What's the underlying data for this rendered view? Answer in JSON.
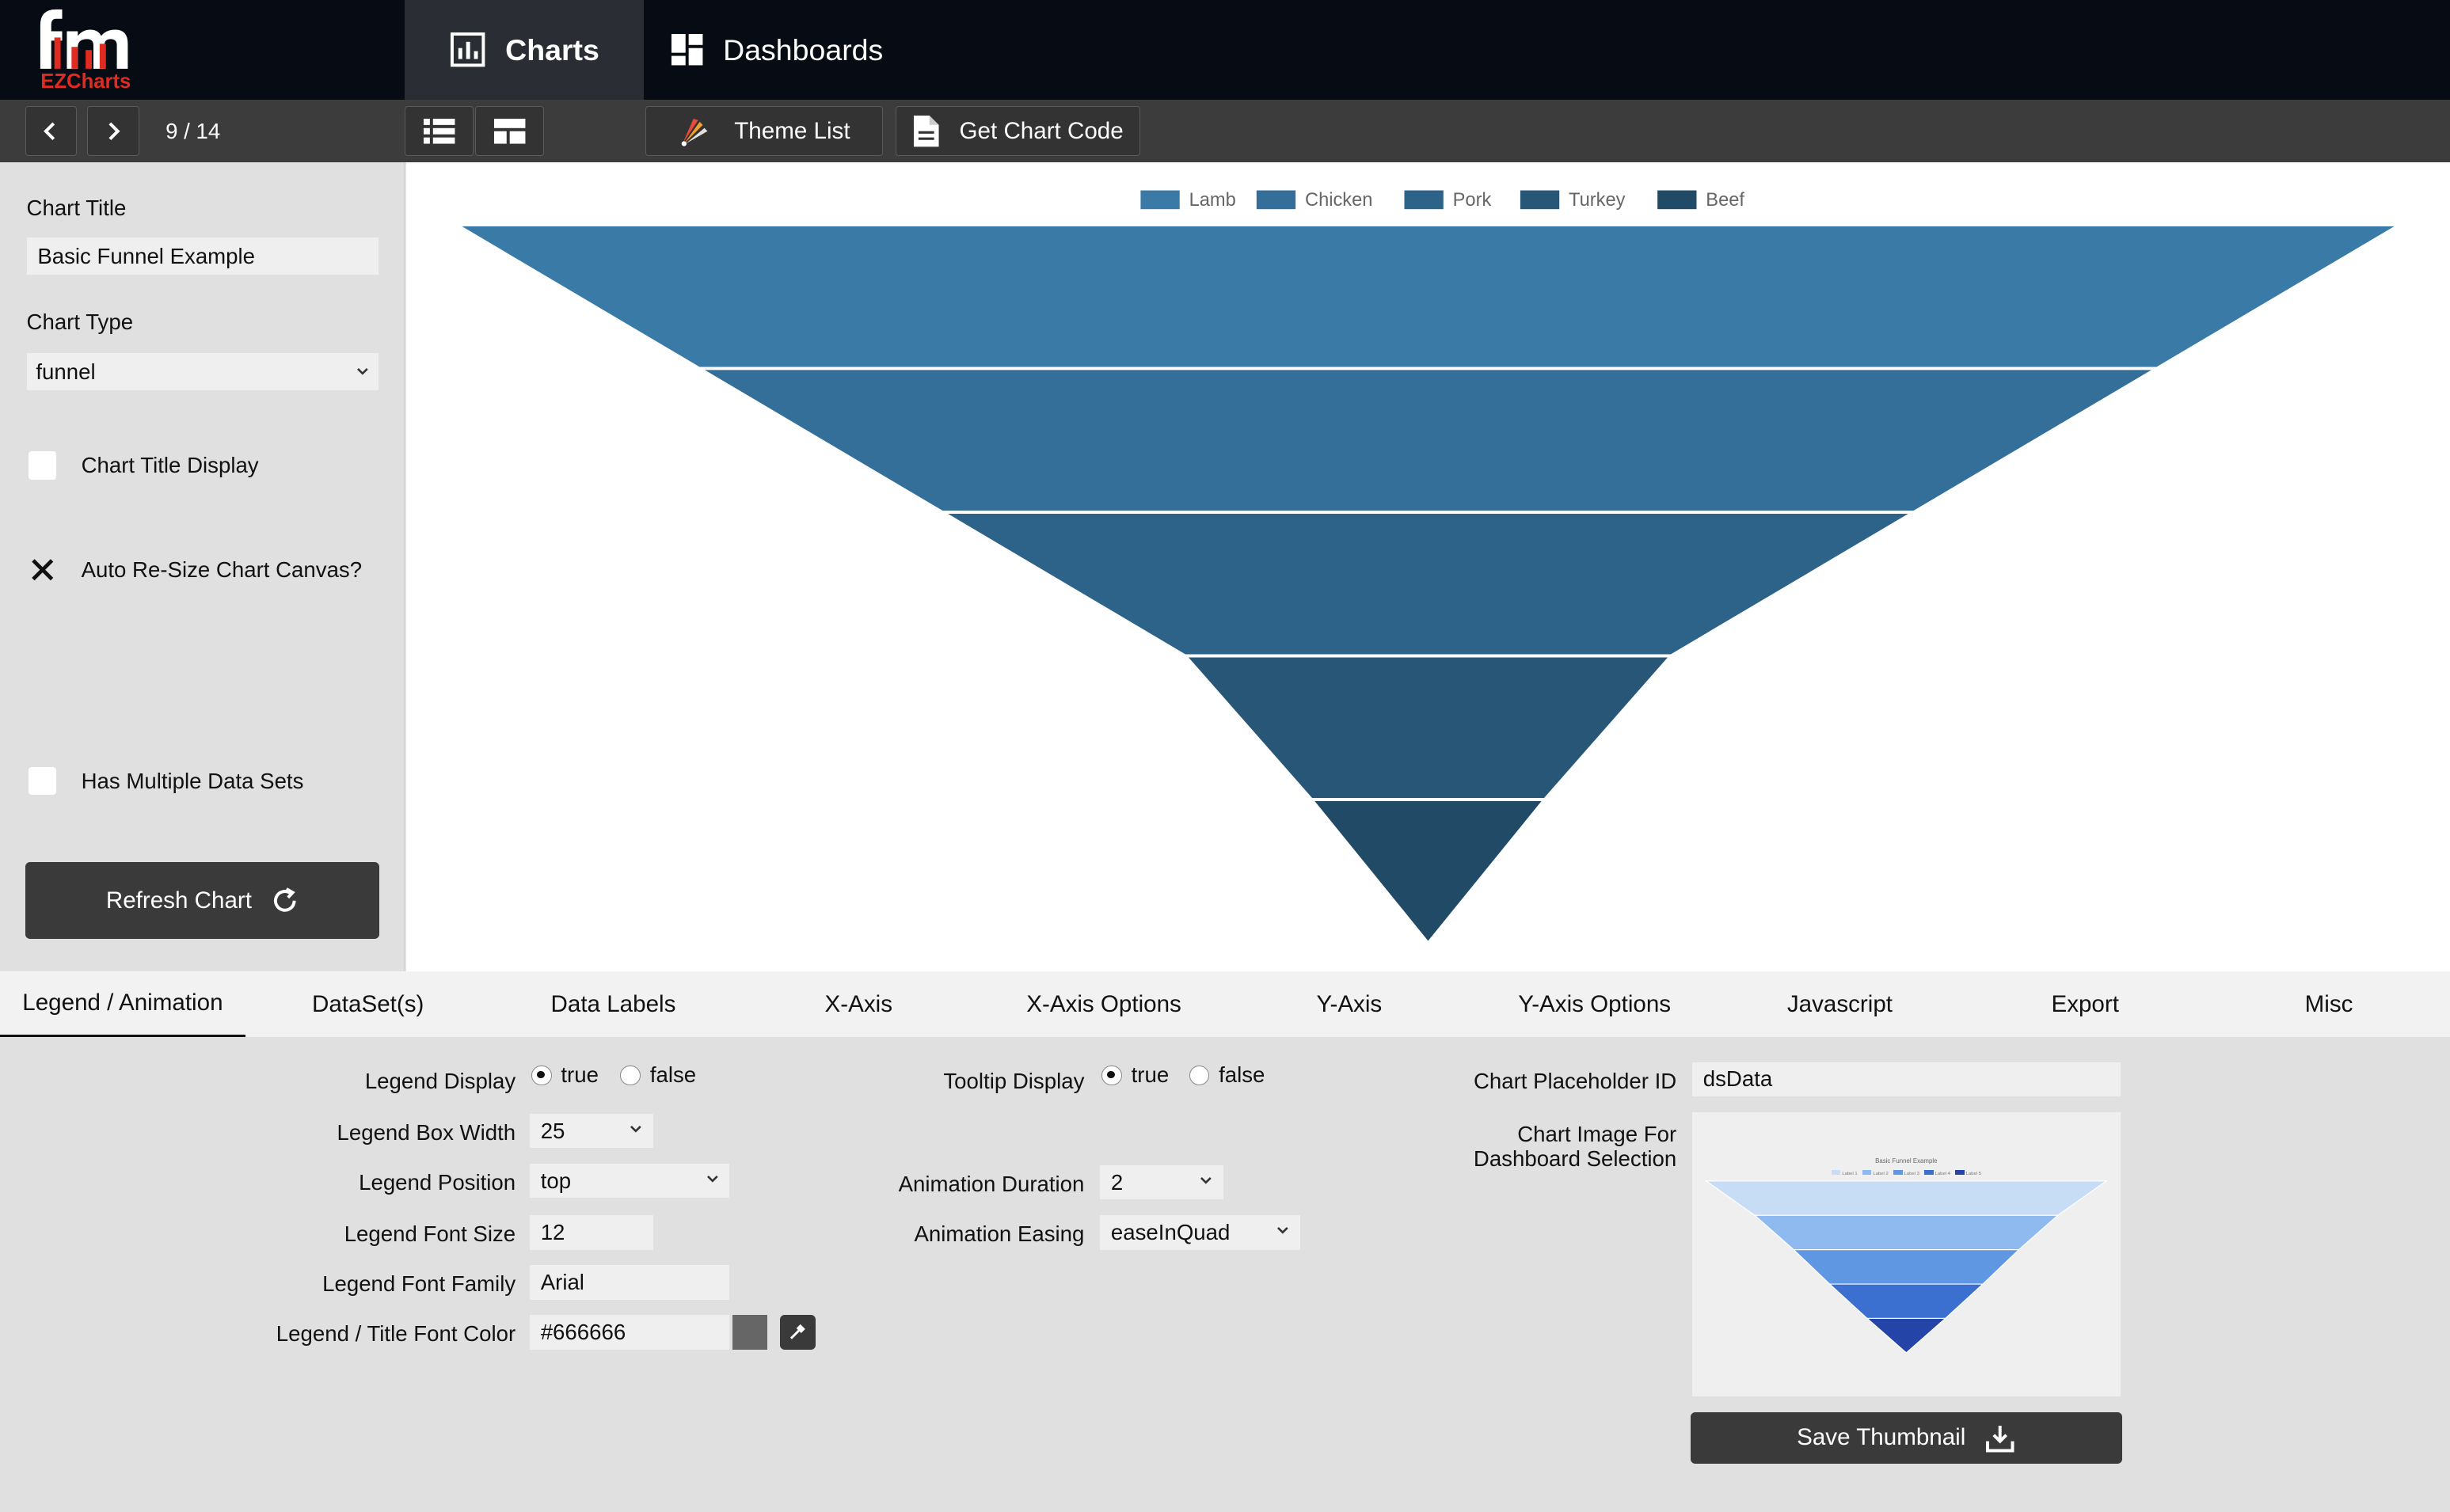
{
  "app": {
    "logo_text": "fm",
    "logo_subtext": "EZCharts",
    "nav_tabs": [
      {
        "label": "Charts",
        "icon": "bar-chart-icon"
      },
      {
        "label": "Dashboards",
        "icon": "dashboard-grid-icon"
      }
    ]
  },
  "toolbar": {
    "pager": "9 / 14",
    "theme_list_label": "Theme List",
    "get_code_label": "Get Chart Code"
  },
  "left_panel": {
    "chart_title_label": "Chart Title",
    "chart_title_value": "Basic Funnel Example",
    "chart_type_label": "Chart Type",
    "chart_type_value": "funnel",
    "title_display_label": "Chart Title Display",
    "title_display_checked": false,
    "auto_resize_label": "Auto Re-Size Chart Canvas?",
    "auto_resize_checked": true,
    "multi_dataset_label": "Has Multiple Data Sets",
    "multi_dataset_checked": false,
    "refresh_label": "Refresh Chart"
  },
  "chart_data": {
    "type": "funnel",
    "categories": [
      "Lamb",
      "Chicken",
      "Pork",
      "Turkey",
      "Beef"
    ],
    "values": [
      100,
      75,
      50,
      30,
      0
    ],
    "colors": [
      "#3a7aa6",
      "#336f99",
      "#2d6389",
      "#275677",
      "#214a66"
    ],
    "legend_position": "top",
    "title": ""
  },
  "tabs": [
    "Legend / Animation",
    "DataSet(s)",
    "Data Labels",
    "X-Axis",
    "X-Axis Options",
    "Y-Axis",
    "Y-Axis Options",
    "Javascript",
    "Export",
    "Misc"
  ],
  "legend_form": {
    "legend_display_label": "Legend Display",
    "true_label": "true",
    "false_label": "false",
    "legend_display_value": "true",
    "box_width_label": "Legend Box Width",
    "box_width_value": "25",
    "position_label": "Legend Position",
    "position_value": "top",
    "font_size_label": "Legend Font Size",
    "font_size_value": "12",
    "font_family_label": "Legend Font Family",
    "font_family_value": "Arial",
    "font_color_label": "Legend / Title Font Color",
    "font_color_value": "#666666",
    "swatch_color": "#666666"
  },
  "animation_form": {
    "tooltip_label": "Tooltip Display",
    "tooltip_value": "true",
    "duration_label": "Animation Duration",
    "duration_value": "2",
    "easing_label": "Animation Easing",
    "easing_value": "easeInQuad"
  },
  "placeholder_form": {
    "placeholder_label": "Chart Placeholder ID",
    "placeholder_value": "dsData",
    "image_label_1": "Chart Image For",
    "image_label_2": "Dashboard Selection",
    "thumb_title": "Basic Funnel Example",
    "thumb_legend": [
      "Label 1",
      "Label 2",
      "Label 3",
      "Label 4",
      "Label 5"
    ],
    "thumb_colors": [
      "#c7dcf5",
      "#8fbaf0",
      "#5f97e3",
      "#3b6fd0",
      "#2444a8"
    ],
    "save_thumb_label": "Save Thumbnail"
  }
}
